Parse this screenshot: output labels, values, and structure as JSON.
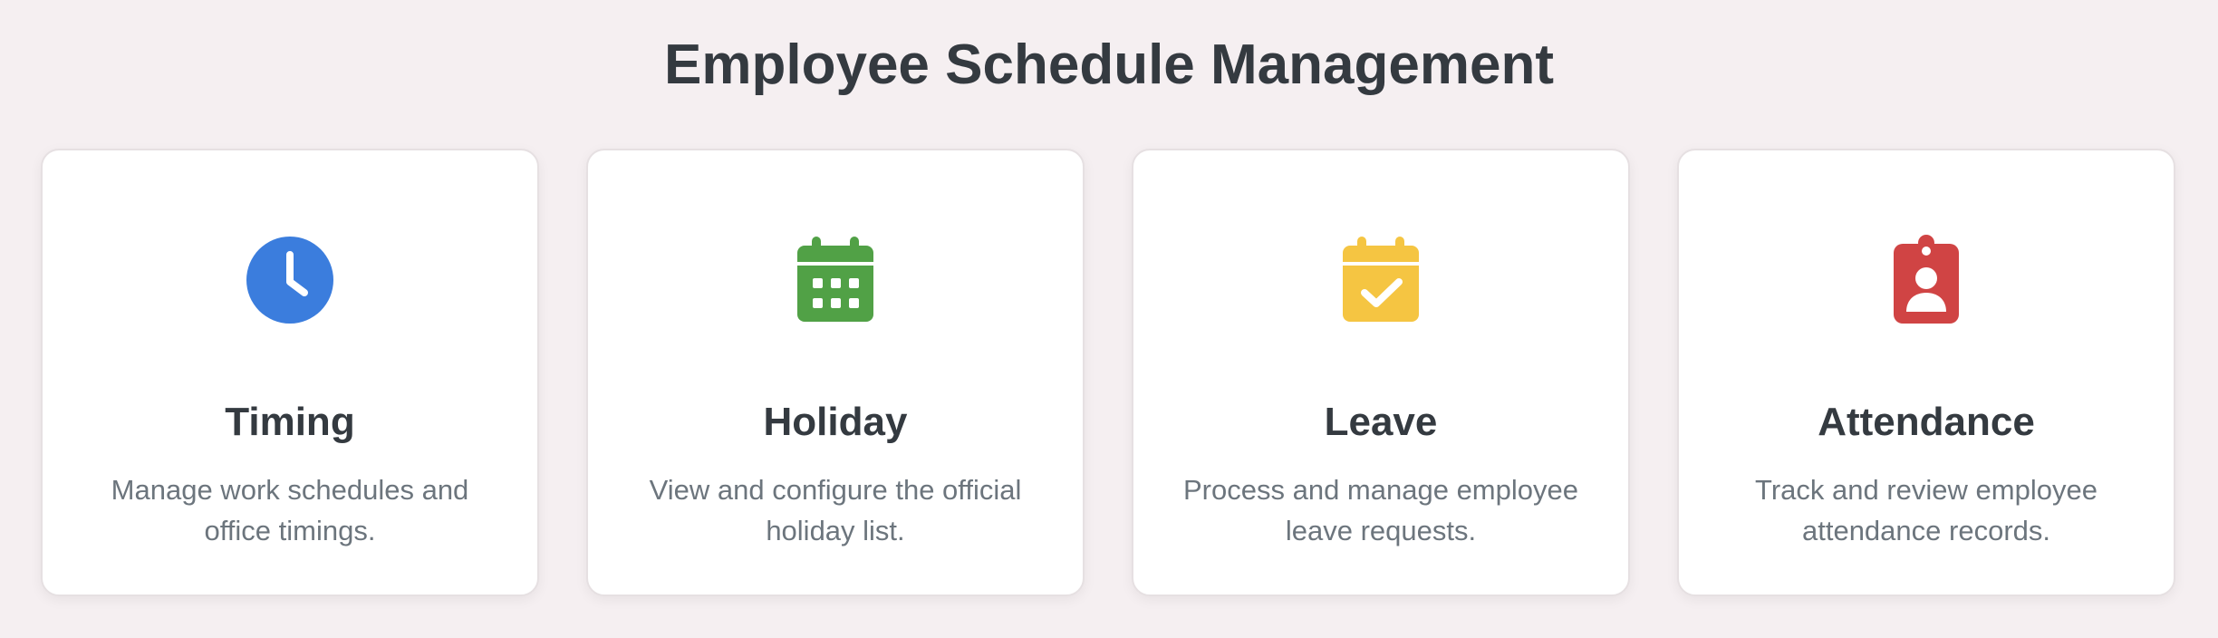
{
  "page": {
    "title": "Employee Schedule Management"
  },
  "colors": {
    "background": "#f5eff1",
    "timing": "#3b7ddd",
    "holiday": "#51a146",
    "leave": "#f5c542",
    "attendance": "#d04444"
  },
  "cards": [
    {
      "icon": "clock-icon",
      "title": "Timing",
      "description": "Manage work schedules and office timings."
    },
    {
      "icon": "calendar-grid-icon",
      "title": "Holiday",
      "description": "View and configure the official holiday list."
    },
    {
      "icon": "calendar-check-icon",
      "title": "Leave",
      "description": "Process and manage employee leave requests."
    },
    {
      "icon": "id-badge-icon",
      "title": "Attendance",
      "description": "Track and review employee attendance records."
    }
  ]
}
